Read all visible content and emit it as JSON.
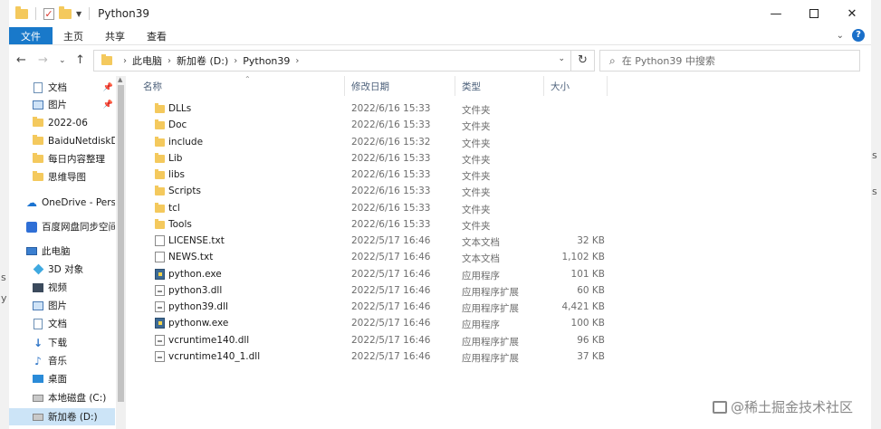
{
  "window": {
    "title": "Python39"
  },
  "ribbon": {
    "tabs": [
      "文件",
      "主页",
      "共享",
      "查看"
    ]
  },
  "address": {
    "crumbs": [
      "此电脑",
      "新加卷 (D:)",
      "Python39"
    ]
  },
  "search": {
    "placeholder": "在 Python39 中搜索"
  },
  "sidebar": {
    "items": [
      {
        "label": "文档",
        "pinned": true,
        "icon": "document-icon"
      },
      {
        "label": "图片",
        "pinned": true,
        "icon": "pictures-icon"
      },
      {
        "label": "2022-06",
        "icon": "folder-icon"
      },
      {
        "label": "BaiduNetdiskDo",
        "icon": "folder-icon"
      },
      {
        "label": "每日内容整理",
        "icon": "folder-icon"
      },
      {
        "label": "思维导图",
        "icon": "folder-icon"
      },
      {
        "label": "OneDrive - Perso",
        "icon": "cloud-icon"
      },
      {
        "label": "百度网盘同步空间",
        "icon": "baidu-icon"
      },
      {
        "label": "此电脑",
        "icon": "pc-icon"
      },
      {
        "label": "3D 对象",
        "icon": "3d-objects-icon"
      },
      {
        "label": "视频",
        "icon": "video-icon"
      },
      {
        "label": "图片",
        "icon": "pictures-icon"
      },
      {
        "label": "文档",
        "icon": "document-icon"
      },
      {
        "label": "下载",
        "icon": "download-icon"
      },
      {
        "label": "音乐",
        "icon": "music-icon"
      },
      {
        "label": "桌面",
        "icon": "desktop-icon"
      },
      {
        "label": "本地磁盘 (C:)",
        "icon": "drive-icon"
      },
      {
        "label": "新加卷 (D:)",
        "icon": "drive-icon",
        "selected": true
      }
    ]
  },
  "columns": {
    "name": "名称",
    "date": "修改日期",
    "type": "类型",
    "size": "大小"
  },
  "files": [
    {
      "name": "DLLs",
      "date": "2022/6/16 15:33",
      "type": "文件夹",
      "size": "",
      "kind": "folder"
    },
    {
      "name": "Doc",
      "date": "2022/6/16 15:33",
      "type": "文件夹",
      "size": "",
      "kind": "folder"
    },
    {
      "name": "include",
      "date": "2022/6/16 15:32",
      "type": "文件夹",
      "size": "",
      "kind": "folder"
    },
    {
      "name": "Lib",
      "date": "2022/6/16 15:33",
      "type": "文件夹",
      "size": "",
      "kind": "folder"
    },
    {
      "name": "libs",
      "date": "2022/6/16 15:33",
      "type": "文件夹",
      "size": "",
      "kind": "folder"
    },
    {
      "name": "Scripts",
      "date": "2022/6/16 15:33",
      "type": "文件夹",
      "size": "",
      "kind": "folder"
    },
    {
      "name": "tcl",
      "date": "2022/6/16 15:33",
      "type": "文件夹",
      "size": "",
      "kind": "folder"
    },
    {
      "name": "Tools",
      "date": "2022/6/16 15:33",
      "type": "文件夹",
      "size": "",
      "kind": "folder"
    },
    {
      "name": "LICENSE.txt",
      "date": "2022/5/17 16:46",
      "type": "文本文档",
      "size": "32 KB",
      "kind": "txt"
    },
    {
      "name": "NEWS.txt",
      "date": "2022/5/17 16:46",
      "type": "文本文档",
      "size": "1,102 KB",
      "kind": "txt"
    },
    {
      "name": "python.exe",
      "date": "2022/5/17 16:46",
      "type": "应用程序",
      "size": "101 KB",
      "kind": "exe"
    },
    {
      "name": "python3.dll",
      "date": "2022/5/17 16:46",
      "type": "应用程序扩展",
      "size": "60 KB",
      "kind": "dll"
    },
    {
      "name": "python39.dll",
      "date": "2022/5/17 16:46",
      "type": "应用程序扩展",
      "size": "4,421 KB",
      "kind": "dll"
    },
    {
      "name": "pythonw.exe",
      "date": "2022/5/17 16:46",
      "type": "应用程序",
      "size": "100 KB",
      "kind": "exe"
    },
    {
      "name": "vcruntime140.dll",
      "date": "2022/5/17 16:46",
      "type": "应用程序扩展",
      "size": "96 KB",
      "kind": "dll"
    },
    {
      "name": "vcruntime140_1.dll",
      "date": "2022/5/17 16:46",
      "type": "应用程序扩展",
      "size": "37 KB",
      "kind": "dll"
    }
  ],
  "watermark": "@稀土掘金技术社区",
  "edge_fragments": {
    "left_1": "s",
    "left_2": "y",
    "right_1": "s",
    "right_2": "s"
  }
}
